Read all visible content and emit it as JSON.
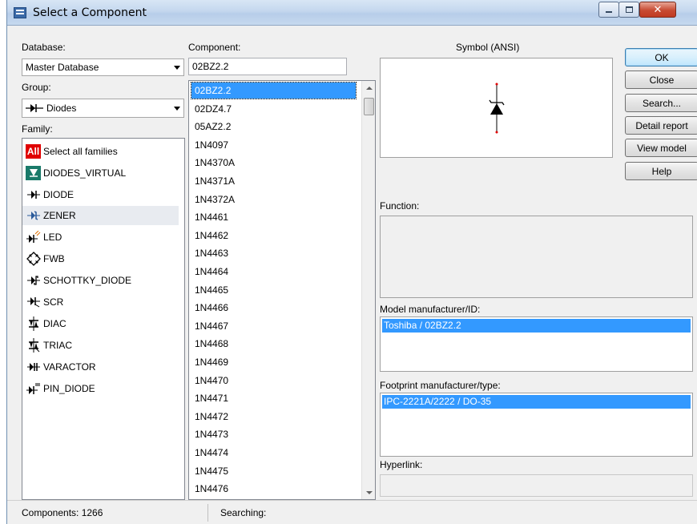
{
  "window": {
    "title": "Select a Component"
  },
  "left": {
    "database_label": "Database:",
    "database_value": "Master Database",
    "group_label": "Group:",
    "group_value": "Diodes",
    "family_label": "Family:",
    "families": [
      {
        "label": "Select all families",
        "icon": "all-families-icon"
      },
      {
        "label": "DIODES_VIRTUAL",
        "icon": "diodes-virtual-icon"
      },
      {
        "label": "DIODE",
        "icon": "diode-icon"
      },
      {
        "label": "ZENER",
        "icon": "zener-icon",
        "selected": true
      },
      {
        "label": "LED",
        "icon": "led-icon"
      },
      {
        "label": "FWB",
        "icon": "fwb-icon"
      },
      {
        "label": "SCHOTTKY_DIODE",
        "icon": "schottky-icon"
      },
      {
        "label": "SCR",
        "icon": "scr-icon"
      },
      {
        "label": "DIAC",
        "icon": "diac-icon"
      },
      {
        "label": "TRIAC",
        "icon": "triac-icon"
      },
      {
        "label": "VARACTOR",
        "icon": "varactor-icon"
      },
      {
        "label": "PIN_DIODE",
        "icon": "pin-diode-icon"
      }
    ],
    "all_icon_text": "All"
  },
  "component": {
    "label": "Component:",
    "search_value": "02BZ2.2",
    "items": [
      "02BZ2.2",
      "02DZ4.7",
      "05AZ2.2",
      "1N4097",
      "1N4370A",
      "1N4371A",
      "1N4372A",
      "1N4461",
      "1N4462",
      "1N4463",
      "1N4464",
      "1N4465",
      "1N4466",
      "1N4467",
      "1N4468",
      "1N4469",
      "1N4470",
      "1N4471",
      "1N4472",
      "1N4473",
      "1N4474",
      "1N4475",
      "1N4476"
    ],
    "selected_index": 0
  },
  "right": {
    "symbol_label": "Symbol (ANSI)",
    "function_label": "Function:",
    "model_label": "Model manufacturer/ID:",
    "model_value": "Toshiba / 02BZ2.2",
    "footprint_label": "Footprint manufacturer/type:",
    "footprint_value": "IPC-2221A/2222 / DO-35",
    "hyperlink_label": "Hyperlink:"
  },
  "buttons": {
    "ok": "OK",
    "close": "Close",
    "search": "Search...",
    "detail_report": "Detail report",
    "view_model": "View model",
    "help": "Help"
  },
  "status": {
    "components": "Components: 1266",
    "searching": "Searching:"
  },
  "colors": {
    "selection": "#3399ff",
    "all_icon_bg": "#e00000",
    "virtual_icon_bg": "#1a7a6a"
  }
}
